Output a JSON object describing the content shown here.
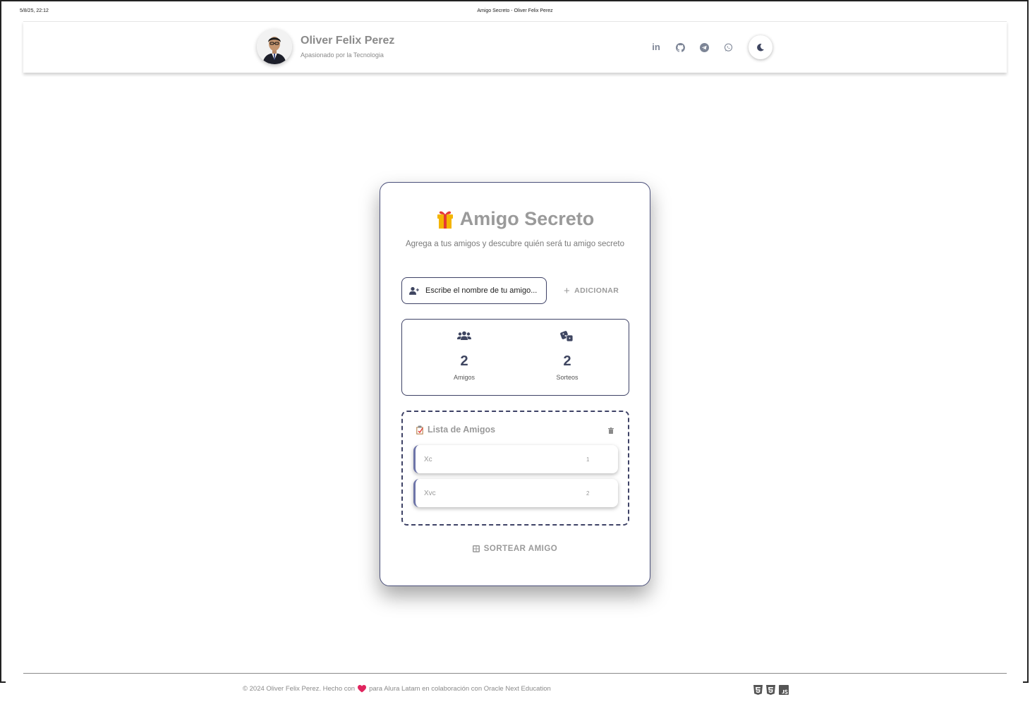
{
  "print": {
    "date": "5/8/25, 22:12",
    "title": "Amigo Secreto - Oliver Felix Perez"
  },
  "header": {
    "name": "Oliver Felix Perez",
    "tagline": "Apasionado por la Tecnologia",
    "social": [
      "linkedin-icon",
      "github-icon",
      "telegram-icon",
      "whatsapp-icon"
    ],
    "linkedin_label": "in",
    "theme_toggle_icon": "moon-icon"
  },
  "card": {
    "title_icon": "gift-icon",
    "title": "Amigo Secreto",
    "subtitle": "Agrega a tus amigos y descubre quién será tu amigo secreto",
    "input_placeholder": "Escribe el nombre de tu amigo...",
    "add_label": "ADICIONAR",
    "stats": {
      "friends_value": "2",
      "friends_label": "Amigos",
      "draws_value": "2",
      "draws_label": "Sorteos"
    },
    "list": {
      "title": "Lista de Amigos",
      "items": [
        {
          "name": "Xc",
          "index": "1"
        },
        {
          "name": "Xvc",
          "index": "2"
        }
      ]
    },
    "draw_label": "SORTEAR AMIGO"
  },
  "footer": {
    "text_before": "© 2024 Oliver Felix Perez. Hecho con",
    "text_after": "para Alura Latam en colaboración con Oracle Next Education",
    "tech": [
      "html5-icon",
      "css3-icon",
      "js-icon"
    ]
  },
  "colors": {
    "accent": "#3e4266",
    "muted_text": "#9a9a9a",
    "heart": "#e0245e"
  }
}
